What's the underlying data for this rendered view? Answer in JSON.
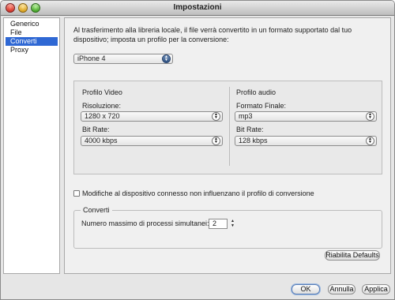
{
  "window": {
    "title": "Impostazioni"
  },
  "sidebar": {
    "items": [
      {
        "label": "Generico"
      },
      {
        "label": "File"
      },
      {
        "label": "Converti",
        "selected": true
      },
      {
        "label": "Proxy"
      }
    ]
  },
  "main": {
    "intro": "Al trasferimento alla libreria locale, il file verrà convertito in un formato supportato dal tuo dispositivo; imposta un profilo per la conversione:",
    "device_profile": "iPhone 4",
    "video": {
      "heading": "Profilo Video",
      "resolution_label": "Risoluzione:",
      "resolution_value": "1280 x 720",
      "bitrate_label": "Bit Rate:",
      "bitrate_value": "4000 kbps"
    },
    "audio": {
      "heading": "Profilo audio",
      "format_label": "Formato Finale:",
      "format_value": "mp3",
      "bitrate_label": "Bit Rate:",
      "bitrate_value": "128 kbps"
    },
    "checkbox_label": "Modifiche al dispositivo connesso non influenzano il profilo di conversione",
    "checkbox_checked": false,
    "convert_group": {
      "title": "Converti",
      "max_processes_label": "Numero massimo di processi simultanei:",
      "max_processes_value": "2"
    },
    "reset_defaults_label": "Riabilita Defaults"
  },
  "footer": {
    "ok_label": "OK",
    "cancel_label": "Annulla",
    "apply_label": "Applica"
  },
  "colors": {
    "selection": "#2f68d4",
    "window_bg": "#e6e6e6"
  }
}
